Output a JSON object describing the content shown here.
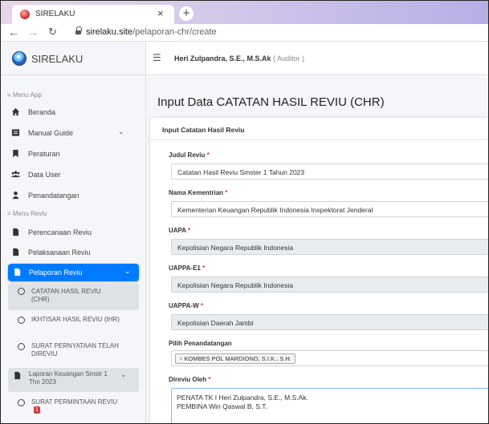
{
  "browser": {
    "tab_title": "SIRELAKU",
    "url_host": "sirelaku.site",
    "url_path": "/pelaporan-chr/create"
  },
  "app": {
    "brand": "SIRELAKU",
    "user_name": "Heri Zulpandra, S.E., M.S.Ak",
    "user_role": "( Auditor )"
  },
  "sidebar": {
    "section_app": "= Menu App",
    "section_reviu": "= Menu Reviu",
    "items": [
      {
        "label": "Beranda",
        "icon": "home-icon"
      },
      {
        "label": "Manual Guide",
        "icon": "book-icon",
        "chevron": "⌄"
      },
      {
        "label": "Peraturan",
        "icon": "bookmark-icon"
      },
      {
        "label": "Data User",
        "icon": "users-icon"
      },
      {
        "label": "Penandatangan",
        "icon": "user-icon"
      }
    ],
    "reviu_items": [
      {
        "label": "Perencanaan Reviu",
        "icon": "file-icon"
      },
      {
        "label": "Pelaksanaan Reviu",
        "icon": "file-icon"
      },
      {
        "label": "Pelaporan Reviu",
        "icon": "file-icon",
        "chevron": "⌄"
      }
    ],
    "sub_items": [
      {
        "label": "CATATAN HASIL REVIU (CHR)"
      },
      {
        "label": "IKHTISAR HASIL REVIU (IHR)"
      },
      {
        "label": "SURAT PERNYATAAN TELAH DIREVIU"
      }
    ],
    "group_item": {
      "label": "Laporan Keuangan Smstr 1 Thn 2023",
      "chevron": "⌄"
    },
    "last_sub": {
      "label": "SURAT PERMINTAAN REVIU",
      "badge": "1"
    }
  },
  "page": {
    "title": "Input Data CATATAN HASIL REVIU (CHR)",
    "card_title": "Input Catatan Hasil Reviu"
  },
  "form": {
    "judul_label": "Judul Reviu",
    "judul_value": "Catatan Hasil Reviu Smster 1 Tahun 2023",
    "kementrian_label": "Nama Kementrian",
    "kementrian_value": "Kementerian Keuangan Republik Indonesia Inspektorat Jenderal",
    "uapa_label": "UAPA",
    "uapa_value": "Kepolisian Negara Republik Indonesia",
    "uappa_e1_label": "UAPPA-E1",
    "uappa_e1_value": "Kepolisian Negara Republik Indonesia",
    "uappa_w_label": "UAPPA-W",
    "uappa_w_value": "Kepolisian Daerah Jambi",
    "penandatangan_label": "Pilih Penandatangan",
    "penandatangan_tag": "KOMBES POL MARDIONO, S.I.K., S.H.",
    "direviu_label": "Direviu Oleh",
    "direviu_lines": [
      "PENATA TK I Heri  Zulpandra, S.E., M.S.Ak.",
      "PEMBINA Win Qaswal B, S.T."
    ],
    "required_mark": "*"
  },
  "colors": {
    "primary": "#007bff",
    "danger": "#dc3545",
    "sidebar_bg": "#f4f6f9"
  }
}
